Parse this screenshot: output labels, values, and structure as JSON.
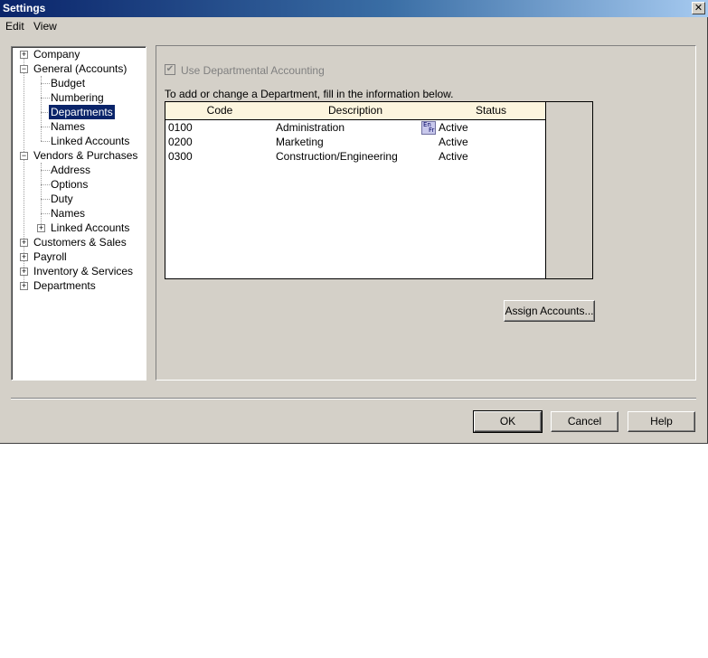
{
  "window": {
    "title": "Settings",
    "close": "✕"
  },
  "menu": {
    "edit": "Edit",
    "view": "View"
  },
  "tree": {
    "company": "Company",
    "general": "General (Accounts)",
    "budget": "Budget",
    "numbering": "Numbering",
    "departments": "Departments",
    "names": "Names",
    "linked_accounts": "Linked Accounts",
    "vendors": "Vendors & Purchases",
    "address": "Address",
    "options": "Options",
    "duty": "Duty",
    "vnames": "Names",
    "vlinked": "Linked Accounts",
    "customers": "Customers & Sales",
    "payroll": "Payroll",
    "inventory": "Inventory & Services",
    "departments_root": "Departments"
  },
  "main": {
    "checkbox_label": "Use Departmental Accounting",
    "checkbox_checked": true,
    "instruction": "To add or change a Department, fill in the information below.",
    "columns": {
      "code": "Code",
      "description": "Description",
      "status": "Status"
    },
    "rows": [
      {
        "code": "0100",
        "description": "Administration",
        "status": "Active"
      },
      {
        "code": "0200",
        "description": "Marketing",
        "status": "Active"
      },
      {
        "code": "0300",
        "description": "Construction/Engineering",
        "status": "Active"
      }
    ],
    "language_icon": {
      "line1": "En",
      "line2": "Fr"
    },
    "assign_button": "Assign Accounts..."
  },
  "footer": {
    "ok": "OK",
    "cancel": "Cancel",
    "help": "Help"
  },
  "colors": {
    "title_start": "#0a246a",
    "title_end": "#a6caf0",
    "selection": "#0a246a",
    "header_bg": "#fcf5de"
  }
}
